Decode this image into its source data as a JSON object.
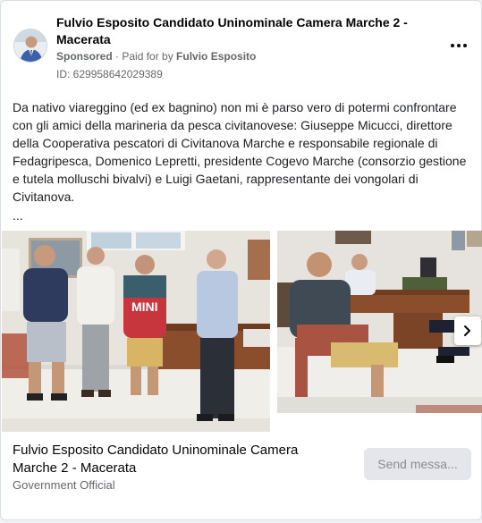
{
  "post": {
    "page_name": "Fulvio Esposito Candidato Uninominale Camera Marche 2 - Macerata",
    "sponsored_label": "Sponsored",
    "separator": " · ",
    "paid_for_prefix": "Paid for by ",
    "payer": "Fulvio Esposito",
    "ad_id": "ID: 629958642029389",
    "body": "Da nativo viareggino (ed ex bagnino) non mi è parso vero di potermi confrontare con gli amici della marineria da pesca civitanovese: Giuseppe Micucci, direttore della Cooperativa pescatori di Civitanova Marche e responsabile regionale di Fedagripesca, Domenico Lepretti, presidente Cogevo Marche (consorzio gestione e tutela molluschi bivalvi) e Luigi Gaetani, rappresentante dei vongolari di Civitanova.",
    "truncation": "..."
  },
  "icons": {
    "more": "more-options-icon",
    "next": "chevron-right-icon"
  },
  "footer": {
    "title": "Fulvio Esposito Candidato Uninominale Camera Marche 2 - Macerata",
    "subtitle": "Government Official",
    "button_label": "Send messa..."
  },
  "colors": {
    "text_primary": "#050505",
    "text_secondary": "#65676b",
    "button_bg": "#e4e6eb",
    "button_text": "#8a8d91"
  }
}
